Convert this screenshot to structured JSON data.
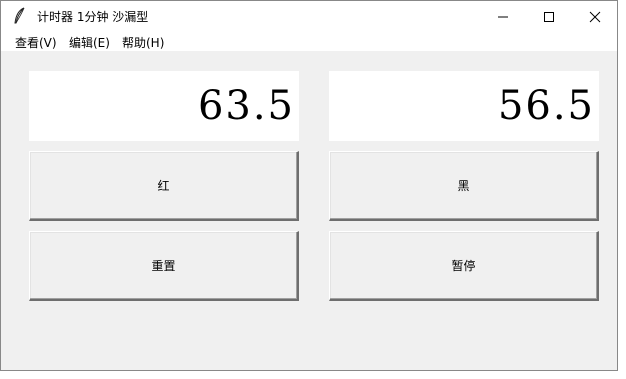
{
  "window": {
    "title": "计时器 1分钟 沙漏型",
    "icon": "feather-icon"
  },
  "menu": {
    "items": [
      {
        "label": "查看(V)"
      },
      {
        "label": "编辑(E)"
      },
      {
        "label": "帮助(H)"
      }
    ]
  },
  "timers": {
    "red_value": "63.5",
    "black_value": "56.5"
  },
  "buttons": {
    "red_label": "红",
    "black_label": "黑",
    "reset_label": "重置",
    "pause_label": "暂停"
  },
  "colors": {
    "background": "#f0f0f0",
    "display_background": "#ffffff"
  }
}
